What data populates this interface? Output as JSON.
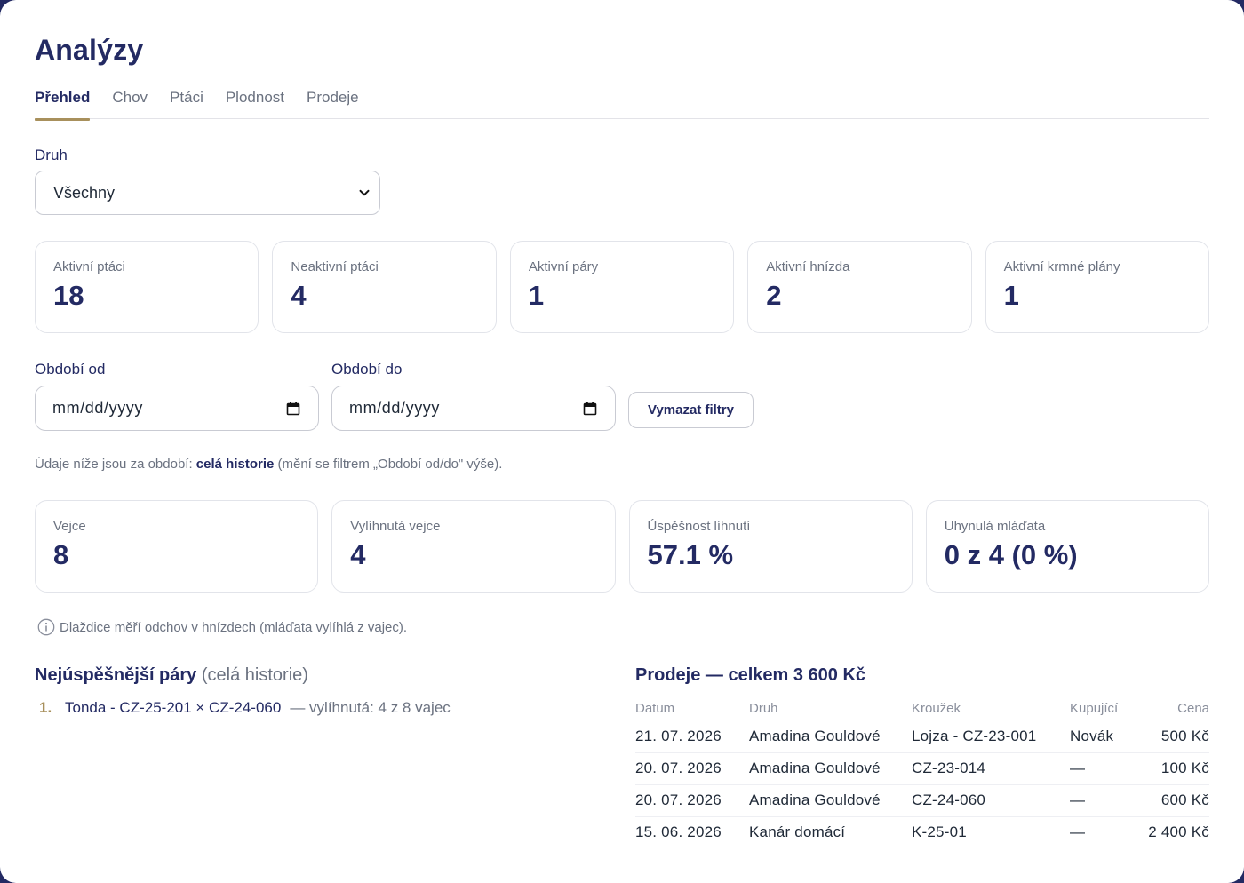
{
  "page": {
    "title": "Analýzy"
  },
  "tabs": [
    {
      "label": "Přehled",
      "active": true
    },
    {
      "label": "Chov",
      "active": false
    },
    {
      "label": "Ptáci",
      "active": false
    },
    {
      "label": "Plodnost",
      "active": false
    },
    {
      "label": "Prodeje",
      "active": false
    }
  ],
  "filter": {
    "druh_label": "Druh",
    "druh_value": "Všechny",
    "od_label": "Období od",
    "od_value": "mm/dd/yyyy",
    "do_label": "Období do",
    "do_value": "mm/dd/yyyy",
    "clear_label": "Vymazat filtry"
  },
  "stats_top": [
    {
      "label": "Aktivní ptáci",
      "value": "18"
    },
    {
      "label": "Neaktivní ptáci",
      "value": "4"
    },
    {
      "label": "Aktivní páry",
      "value": "1"
    },
    {
      "label": "Aktivní hnízda",
      "value": "2"
    },
    {
      "label": "Aktivní krmné plány",
      "value": "1"
    }
  ],
  "period_note": {
    "prefix": "Údaje níže jsou za období: ",
    "bold": "celá historie",
    "suffix": " (mění se filtrem „Období od/do\" výše)."
  },
  "stats_bottom": [
    {
      "label": "Vejce",
      "value": "8"
    },
    {
      "label": "Vylíhnutá vejce",
      "value": "4"
    },
    {
      "label": "Úspěšnost líhnutí",
      "value": "57.1 %"
    },
    {
      "label": "Uhynulá mláďata",
      "value": "0 z 4 (0 %)"
    }
  ],
  "info_note": "Dlaždice měří odchov v hnízdech (mláďata vylíhlá z vajec).",
  "pairs": {
    "title": "Nejúspěšnější páry",
    "subtitle": "(celá historie)",
    "items": [
      {
        "num": "1.",
        "name": "Tonda - CZ-25-201 × CZ-24-060",
        "meta": "— vylíhnutá: 4 z 8 vajec"
      }
    ]
  },
  "sales": {
    "title": "Prodeje — celkem 3 600 Kč",
    "columns": [
      "Datum",
      "Druh",
      "Kroužek",
      "Kupující",
      "Cena"
    ],
    "rows": [
      [
        "21. 07. 2026",
        "Amadina Gouldové",
        "Lojza - CZ-23-001",
        "Novák",
        "500 Kč"
      ],
      [
        "20. 07. 2026",
        "Amadina Gouldové",
        "CZ-23-014",
        "—",
        "100 Kč"
      ],
      [
        "20. 07. 2026",
        "Amadina Gouldové",
        "CZ-24-060",
        "—",
        "600 Kč"
      ],
      [
        "15. 06. 2026",
        "Kanár domácí",
        "K-25-01",
        "—",
        "2 400 Kč"
      ]
    ]
  }
}
